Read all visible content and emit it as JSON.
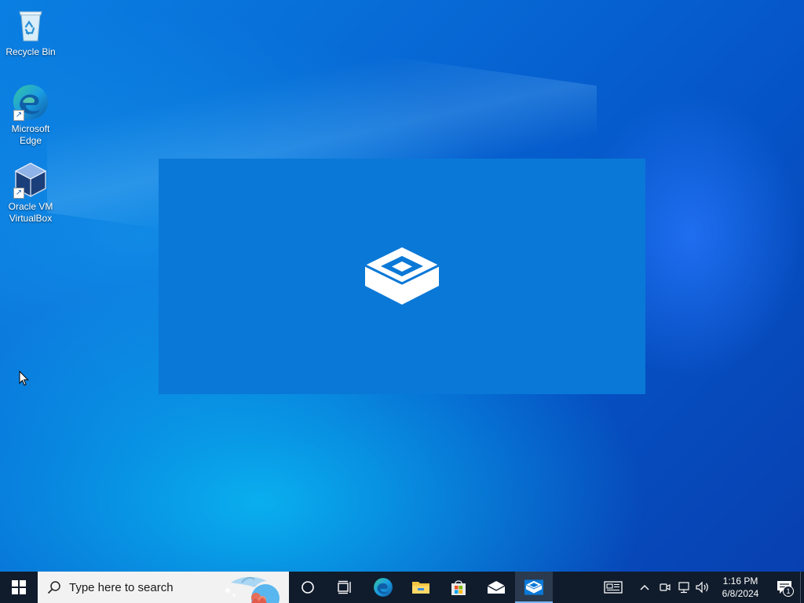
{
  "desktop": {
    "icons": [
      {
        "label": "Recycle Bin",
        "icon": "recycle-bin-icon"
      },
      {
        "label": "Microsoft Edge",
        "icon": "edge-icon",
        "shortcut": true
      },
      {
        "label": "Oracle VM VirtualBox",
        "icon": "virtualbox-icon",
        "shortcut": true
      }
    ],
    "splash": {
      "app": "Windows Sandbox",
      "icon": "sandbox-icon",
      "color": "#0a78d7"
    }
  },
  "taskbar": {
    "start_icon": "windows-start-icon",
    "search": {
      "placeholder": "Type here to search"
    },
    "pinned": [
      {
        "name": "Cortana",
        "icon": "cortana-icon"
      },
      {
        "name": "Task View",
        "icon": "task-view-icon"
      },
      {
        "name": "Microsoft Edge",
        "icon": "edge-icon"
      },
      {
        "name": "File Explorer",
        "icon": "file-explorer-icon"
      },
      {
        "name": "Microsoft Store",
        "icon": "store-icon"
      },
      {
        "name": "Mail",
        "icon": "mail-icon"
      },
      {
        "name": "Windows Sandbox",
        "icon": "sandbox-icon",
        "active": true
      }
    ],
    "tray": {
      "icons": [
        "news-icon",
        "chevron-up-icon",
        "meet-now-icon",
        "network-icon",
        "volume-icon"
      ],
      "time": "1:16 PM",
      "date": "6/8/2024",
      "notifications": "1"
    }
  }
}
